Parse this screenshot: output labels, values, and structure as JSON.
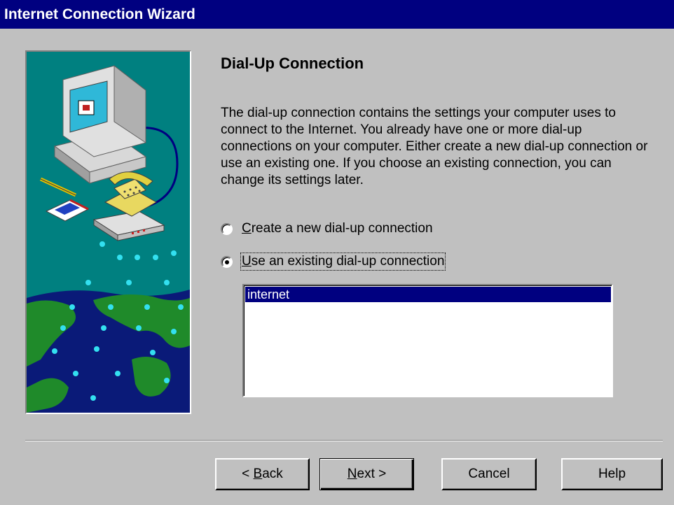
{
  "window": {
    "title": "Internet Connection Wizard"
  },
  "page": {
    "heading": "Dial-Up Connection",
    "description": "The dial-up connection contains the settings your computer uses to connect to the Internet. You already have one or more dial-up connections on your computer. Either create a new dial-up connection or use an existing one. If you choose an existing connection, you can change its settings later."
  },
  "options": {
    "create_new": {
      "mnemonic": "C",
      "rest": "reate a new dial-up connection",
      "selected": false
    },
    "use_existing": {
      "mnemonic": "U",
      "rest": "se an existing dial-up connection",
      "selected": true
    }
  },
  "connections": [
    {
      "name": "internet",
      "selected": true
    }
  ],
  "buttons": {
    "back": {
      "prefix": "< ",
      "mnemonic": "B",
      "rest": "ack"
    },
    "next": {
      "mnemonic": "N",
      "rest": "ext >"
    },
    "cancel": "Cancel",
    "help": "Help"
  },
  "colors": {
    "title_bar": "#000080",
    "dialog_face": "#c0c0c0",
    "selection": "#000080",
    "art_background": "#008080"
  },
  "icons": {
    "illustration": "computer-telephone-globe-illustration"
  }
}
